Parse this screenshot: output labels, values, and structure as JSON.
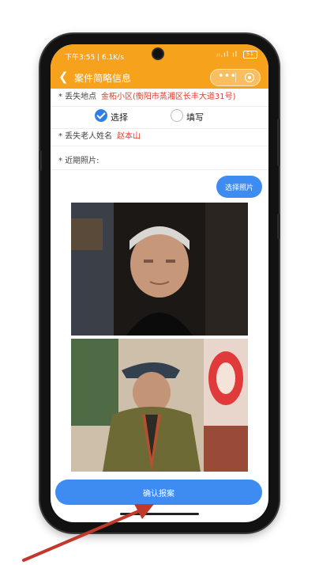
{
  "status_bar": {
    "time": "下午3:55 | 6.1K/s",
    "signal": "ᵢₗ.ıl ıl",
    "battery": "51"
  },
  "nav": {
    "back_icon": "chevron-left-icon",
    "title": "案件简略信息",
    "more_icon": "•••",
    "close_icon": "target-close-icon"
  },
  "form": {
    "location_label": "* 丢失地点",
    "location_value": "金柘小区(衡阳市蒸湘区长丰大道31号)",
    "options": [
      "选择",
      "填写"
    ],
    "selected_option": "选择",
    "name_label": "* 丢失老人姓名",
    "name_value": "赵本山",
    "photos_label": "* 近期照片:",
    "choose_photo_button": "选择照片"
  },
  "photos": [
    "portrait-photo-icon",
    "outdoor-photo-icon"
  ],
  "confirm_button": "确认报案",
  "colors": {
    "header": "#f7a21c",
    "primary": "#3e8cf2",
    "highlight": "#e33b2d",
    "annotation_arrow": "#c0392b"
  }
}
